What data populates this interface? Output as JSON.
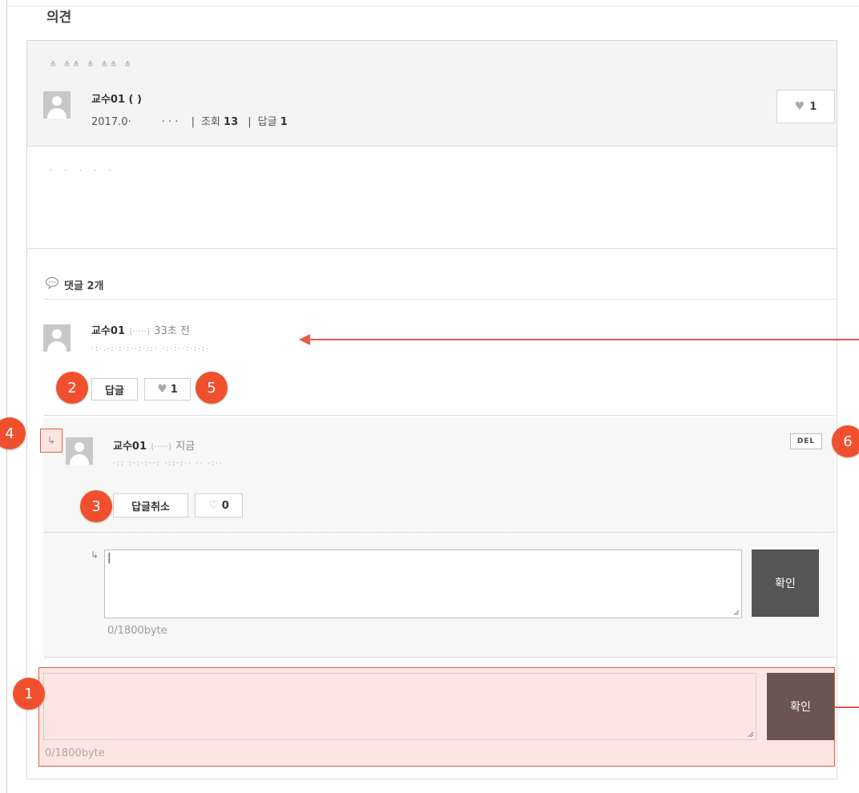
{
  "section_title": "의견",
  "post": {
    "title_text": "≛ ≛≛ ≛ ≛≛ ≛",
    "author": "교수01 (        )",
    "date": "2017.0·",
    "date_tail": "· · ·",
    "views_label": "조회",
    "views": "13",
    "replies_label": "답글",
    "replies": "1",
    "likes": "1",
    "content_text": "· · · · ·"
  },
  "comments": {
    "count_label": "댓글 2개",
    "items": [
      {
        "author": "교수01",
        "id_blur": "(·····)",
        "time": "33초 전",
        "text": "·:·.·:·:·:··:·::·  ·:·:··:·:·:·",
        "reply_btn": "답글",
        "likes": "1"
      }
    ],
    "reply": {
      "arrow": "↳",
      "author": "교수01",
      "id_blur": "(·····)",
      "time": "지금",
      "text": "·::  :·:·:··:  ·::·:··  ··  ·:··",
      "del_label": "DEL",
      "cancel_btn": "답글취소",
      "likes": "0"
    },
    "reply_form": {
      "arrow": "↳",
      "value": "|",
      "confirm": "확인",
      "counter": "0/1800byte"
    },
    "main_form": {
      "confirm": "확인",
      "counter": "0/1800byte"
    }
  },
  "badges": [
    "1",
    "2",
    "3",
    "4",
    "5",
    "6"
  ],
  "colors": {
    "accent": "#f0502e",
    "highlight_bg": "#fde6e1",
    "button_dark": "#555555"
  }
}
